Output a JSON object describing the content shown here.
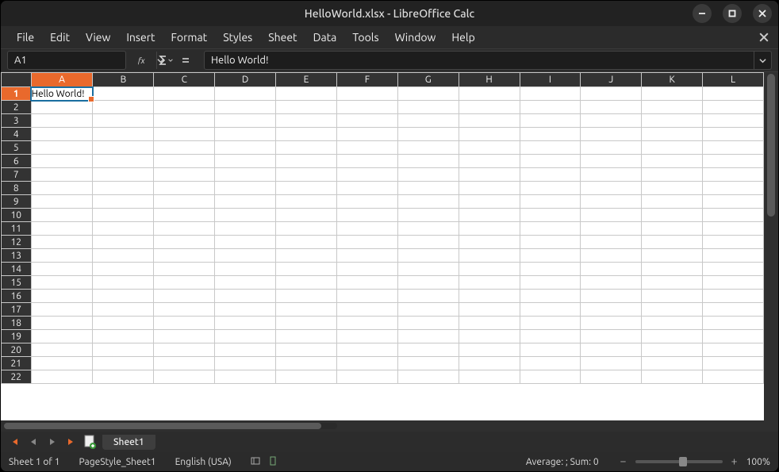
{
  "window": {
    "title": "HelloWorld.xlsx - LibreOffice Calc"
  },
  "menu": {
    "items": [
      "File",
      "Edit",
      "View",
      "Insert",
      "Format",
      "Styles",
      "Sheet",
      "Data",
      "Tools",
      "Window",
      "Help"
    ]
  },
  "formulabar": {
    "cell_ref": "A1",
    "formula": "Hello World!"
  },
  "grid": {
    "columns": [
      "A",
      "B",
      "C",
      "D",
      "E",
      "F",
      "G",
      "H",
      "I",
      "J",
      "K",
      "L"
    ],
    "active_col": "A",
    "rows": 22,
    "active_row": 1,
    "cells": {
      "A1": "Hello World!"
    }
  },
  "tabs": {
    "sheet_name": "Sheet1"
  },
  "status": {
    "sheet_pos": "Sheet 1 of 1",
    "page_style": "PageStyle_Sheet1",
    "language": "English (USA)",
    "summary": "Average: ; Sum: 0",
    "zoom": "100%"
  }
}
